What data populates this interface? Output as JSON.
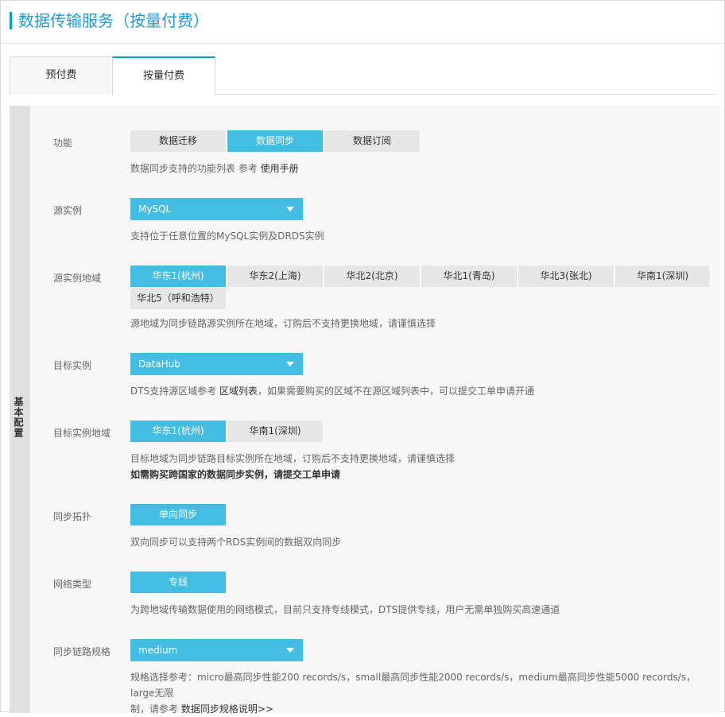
{
  "header": {
    "title": "数据传输服务（按量付费）"
  },
  "tabs": [
    {
      "label": "预付费"
    },
    {
      "label": "按量付费"
    }
  ],
  "sidebar": {
    "label": "基本配置"
  },
  "function": {
    "label": "功能",
    "options": [
      "数据迁移",
      "数据同步",
      "数据订阅"
    ],
    "selected": "数据同步",
    "help_prefix": "数据同步支持的功能列表 参考 ",
    "help_link": "使用手册"
  },
  "source_instance": {
    "label": "源实例",
    "value": "MySQL",
    "help": "支持位于任意位置的MySQL实例及DRDS实例"
  },
  "source_region": {
    "label": "源实例地域",
    "options": [
      "华东1(杭州)",
      "华东2(上海)",
      "华北2(北京)",
      "华北1(青岛)",
      "华北3(张北)",
      "华南1(深圳)",
      "华北5（呼和浩特）"
    ],
    "selected": "华东1(杭州)",
    "help": "源地域为同步链路源实例所在地域，订购后不支持更换地域，请谨慎选择"
  },
  "target_instance": {
    "label": "目标实例",
    "value": "DataHub",
    "help_prefix": "DTS支持源区域参考 ",
    "help_link": "区域列表",
    "help_suffix": "，如果需要购买的区域不在源区域列表中，可以提交工单申请开通"
  },
  "target_region": {
    "label": "目标实例地域",
    "options": [
      "华东1(杭州)",
      "华南1(深圳)"
    ],
    "selected": "华东1(杭州)",
    "help": "目标地域为同步链路目标实例所在地域，订购后不支持更换地域，请谨慎选择",
    "help_bold": "如需购买跨国家的数据同步实例，请提交工单申请"
  },
  "topology": {
    "label": "同步拓扑",
    "value": "单向同步",
    "help": "双向同步可以支持两个RDS实例间的数据双向同步"
  },
  "network": {
    "label": "网络类型",
    "value": "专线",
    "help": "为跨地域传输数据使用的网络模式，目前只支持专线模式，DTS提供专线，用户无需单独购买高速通道"
  },
  "spec": {
    "label": "同步链路规格",
    "value": "medium",
    "help_line1": "规格选择参考：micro最高同步性能200 records/s，small最高同步性能2000 records/s，medium最高同步性能5000 records/s，large无限",
    "help_line2_prefix": "制，请参考 ",
    "help_link": "数据同步规格说明>>"
  },
  "colors": {
    "accent": "#44bde2",
    "title": "#1e9ad6",
    "tab_border": "#00a2ca"
  }
}
